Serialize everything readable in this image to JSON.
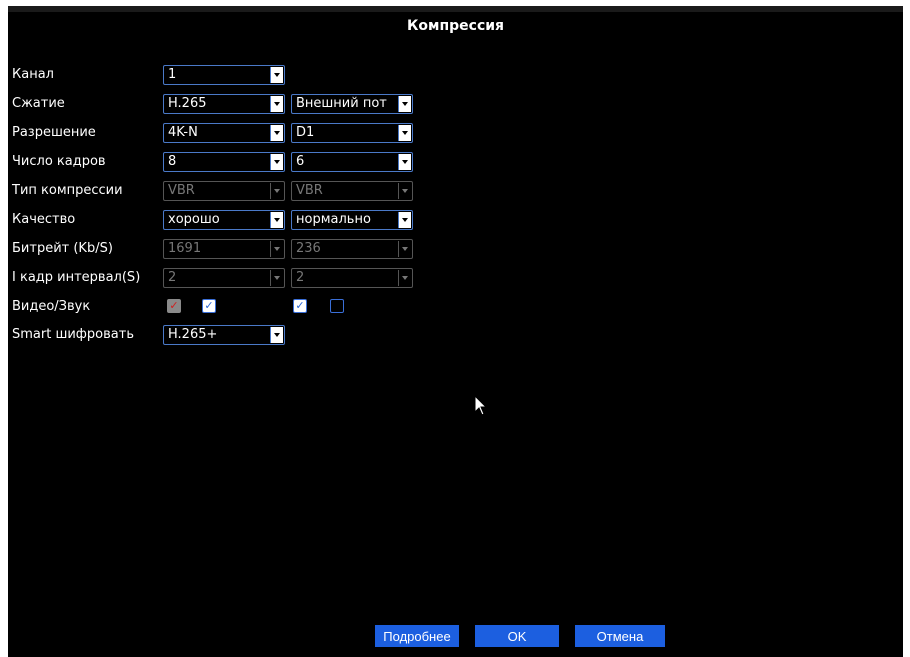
{
  "window": {
    "title": "Компрессия"
  },
  "rows": [
    {
      "label": "Канал",
      "main": {
        "value": "1",
        "disabled": false
      }
    },
    {
      "label": "Сжатие",
      "main": {
        "value": "H.265",
        "disabled": false
      },
      "extra": {
        "value": "Внешний пот",
        "disabled": false
      }
    },
    {
      "label": "Разрешение",
      "main": {
        "value": "4K-N",
        "disabled": false
      },
      "extra": {
        "value": "D1",
        "disabled": false
      }
    },
    {
      "label": "Число кадров",
      "main": {
        "value": "8",
        "disabled": false
      },
      "extra": {
        "value": "6",
        "disabled": false
      }
    },
    {
      "label": "Тип компрессии",
      "main": {
        "value": "VBR",
        "disabled": true
      },
      "extra": {
        "value": "VBR",
        "disabled": true
      }
    },
    {
      "label": "Качество",
      "main": {
        "value": "хорошо",
        "disabled": false
      },
      "extra": {
        "value": "нормально",
        "disabled": false
      }
    },
    {
      "label": "Битрейт (Kb/S)",
      "main": {
        "value": "1691",
        "disabled": true
      },
      "extra": {
        "value": "236",
        "disabled": true
      }
    },
    {
      "label": "I кадр интервал(S)",
      "main": {
        "value": "2",
        "disabled": true
      },
      "extra": {
        "value": "2",
        "disabled": true
      }
    },
    {
      "label": "Видео/Звук"
    },
    {
      "label": "Smart шифровать",
      "main": {
        "value": "H.265+",
        "disabled": false
      }
    }
  ],
  "checkboxes": {
    "main_video": {
      "checked": true,
      "disabled": true
    },
    "main_audio": {
      "checked": true,
      "disabled": false
    },
    "extra_video": {
      "checked": true,
      "disabled": false
    },
    "extra_audio": {
      "checked": false,
      "disabled": false
    }
  },
  "buttons": {
    "advanced": "Подробнее",
    "ok": "OK",
    "cancel": "Отмена"
  }
}
